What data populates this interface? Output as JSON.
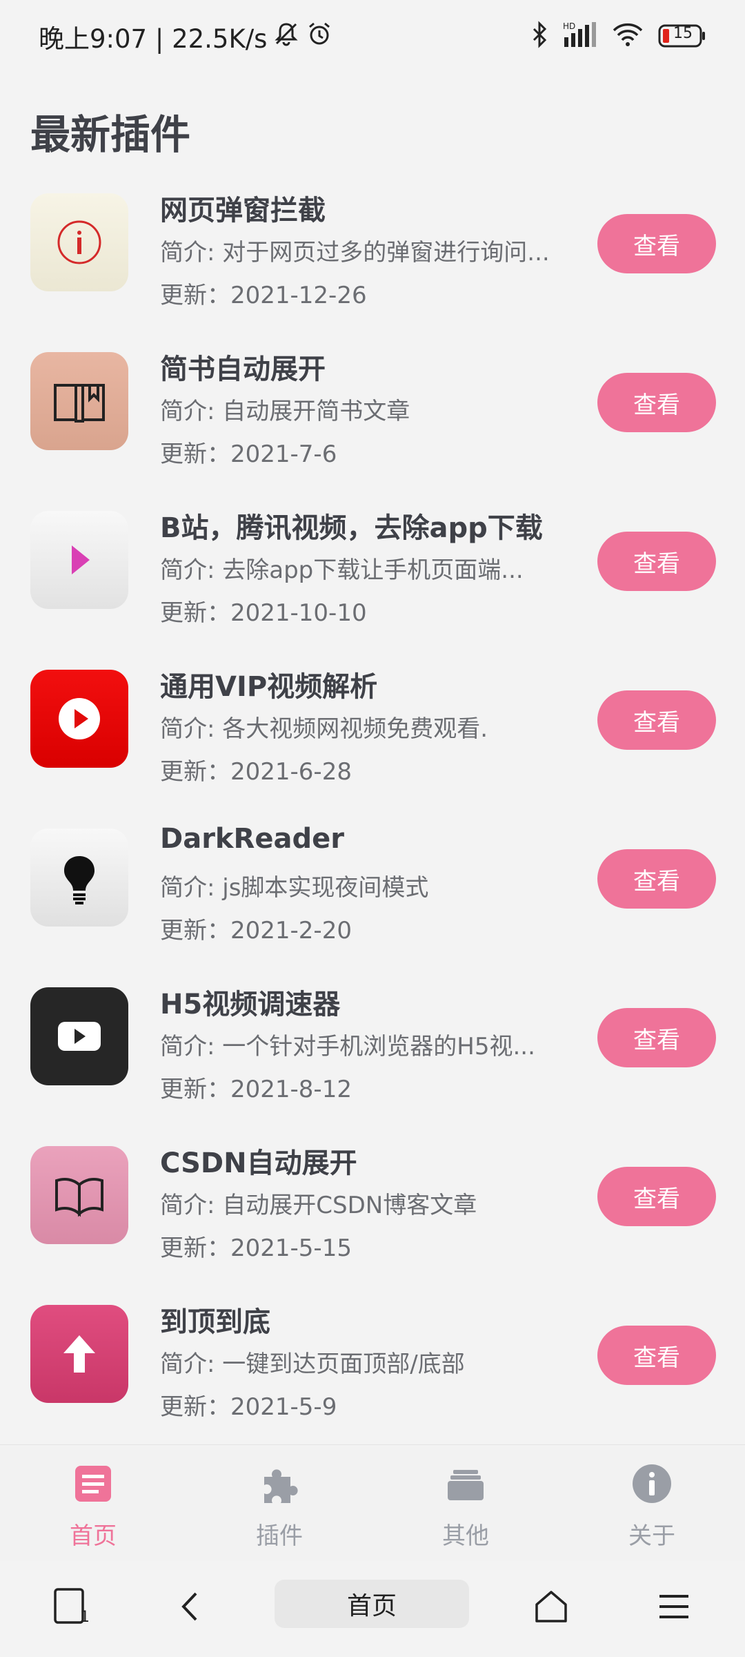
{
  "status_bar": {
    "time_speed": "晚上9:07 | 22.5K/s",
    "battery": "15",
    "hd_label": "HD"
  },
  "page": {
    "title": "最新插件"
  },
  "plugins": [
    {
      "title": "网页弹窗拦截",
      "desc": "简介: 对于网页过多的弹窗进行询问...",
      "update": "更新：2021-12-26",
      "button": "查看",
      "icon": "info-icon"
    },
    {
      "title": "简书自动展开",
      "desc": "简介: 自动展开简书文章",
      "update": "更新：2021-7-6",
      "button": "查看",
      "icon": "book-bookmark-icon"
    },
    {
      "title": "B站，腾讯视频，去除app下载",
      "desc": "简介: 去除app下载让手机页面端...",
      "update": "更新：2021-10-10",
      "button": "查看",
      "icon": "play-triangle-icon"
    },
    {
      "title": "通用VIP视频解析",
      "desc": "简介: 各大视频网视频免费观看.",
      "update": "更新：2021-6-28",
      "button": "查看",
      "icon": "play-circle-icon"
    },
    {
      "title": "DarkReader",
      "desc": "简介: js脚本实现夜间模式",
      "update": "更新：2021-2-20",
      "button": "查看",
      "icon": "lightbulb-icon"
    },
    {
      "title": "H5视频调速器",
      "desc": "简介: 一个针对手机浏览器的H5视...",
      "update": "更新：2021-8-12",
      "button": "查看",
      "icon": "video-play-icon"
    },
    {
      "title": "CSDN自动展开",
      "desc": "简介: 自动展开CSDN博客文章",
      "update": "更新：2021-5-15",
      "button": "查看",
      "icon": "open-book-icon"
    },
    {
      "title": "到顶到底",
      "desc": "简介: 一键到达页面顶部/底部",
      "update": "更新：2021-5-9",
      "button": "查看",
      "icon": "arrow-up-icon"
    }
  ],
  "tabbar": {
    "tabs": [
      {
        "label": "首页",
        "icon": "home-doc-icon",
        "active": true
      },
      {
        "label": "插件",
        "icon": "puzzle-icon",
        "active": false
      },
      {
        "label": "其他",
        "icon": "folder-icon",
        "active": false
      },
      {
        "label": "关于",
        "icon": "info-circle-icon",
        "active": false
      }
    ]
  },
  "navbar": {
    "tabs_count": "1",
    "home_label": "首页"
  },
  "colors": {
    "accent": "#ef7399",
    "inactive": "#9a9ea6",
    "text": "#3f4148"
  }
}
